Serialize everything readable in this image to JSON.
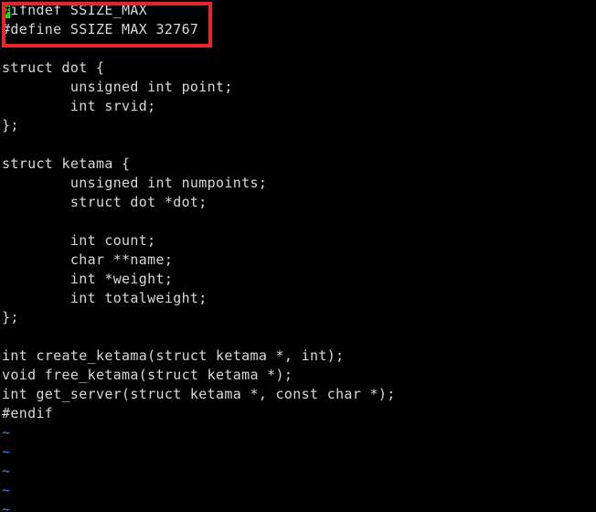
{
  "terminal": {
    "background_color": "#000000",
    "foreground_color": "#d8d8d8",
    "cursor_color": "#15e015",
    "tilde_color": "#3b87e8",
    "cursor_char": "#",
    "lines": [
      {
        "text": "ifndef SSIZE_MAX",
        "kind": "code",
        "cursor": true
      },
      {
        "text": "#define SSIZE MAX 32767",
        "kind": "code"
      },
      {
        "text": "",
        "kind": "code"
      },
      {
        "text": "struct dot {",
        "kind": "code"
      },
      {
        "text": "        unsigned int point;",
        "kind": "code"
      },
      {
        "text": "        int srvid;",
        "kind": "code"
      },
      {
        "text": "};",
        "kind": "code"
      },
      {
        "text": "",
        "kind": "code"
      },
      {
        "text": "struct ketama {",
        "kind": "code"
      },
      {
        "text": "        unsigned int numpoints;",
        "kind": "code"
      },
      {
        "text": "        struct dot *dot;",
        "kind": "code"
      },
      {
        "text": "",
        "kind": "code"
      },
      {
        "text": "        int count;",
        "kind": "code"
      },
      {
        "text": "        char **name;",
        "kind": "code"
      },
      {
        "text": "        int *weight;",
        "kind": "code"
      },
      {
        "text": "        int totalweight;",
        "kind": "code"
      },
      {
        "text": "};",
        "kind": "code"
      },
      {
        "text": "",
        "kind": "code"
      },
      {
        "text": "int create_ketama(struct ketama *, int);",
        "kind": "code"
      },
      {
        "text": "void free_ketama(struct ketama *);",
        "kind": "code"
      },
      {
        "text": "int get_server(struct ketama *, const char *);",
        "kind": "code"
      },
      {
        "text": "#endif",
        "kind": "code"
      },
      {
        "text": "~",
        "kind": "tilde"
      },
      {
        "text": "~",
        "kind": "tilde"
      },
      {
        "text": "~",
        "kind": "tilde"
      },
      {
        "text": "~",
        "kind": "tilde"
      },
      {
        "text": "~",
        "kind": "tilde"
      }
    ]
  },
  "annotation": {
    "label": "red-highlight-rectangle",
    "color": "#e8262a",
    "covers_lines": [
      "#ifndef SSIZE_MAX",
      "#define SSIZE MAX 32767"
    ]
  }
}
